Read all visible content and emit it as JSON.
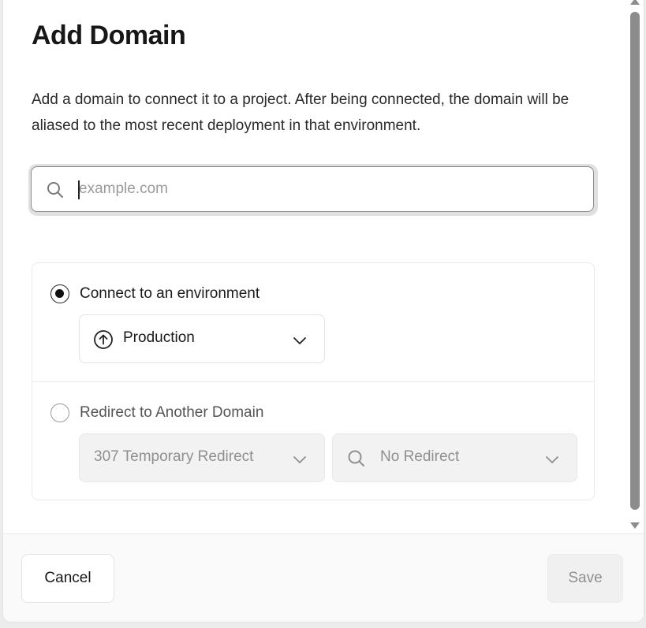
{
  "dialog": {
    "title": "Add Domain",
    "description": "Add a domain to connect it to a project. After being connected, the domain will be aliased to the most recent deployment in that environment."
  },
  "domain_input": {
    "value": "",
    "placeholder": "example.com",
    "icon": "search-icon"
  },
  "connect_option": {
    "label": "Connect to an environment",
    "selected": true,
    "environment_select": {
      "icon": "arrow-up-circle-icon",
      "value": "Production"
    }
  },
  "redirect_option": {
    "label": "Redirect to Another Domain",
    "selected": false,
    "redirect_type_select": {
      "value": "307 Temporary Redirect"
    },
    "redirect_target_select": {
      "icon": "search-icon",
      "value": "No Redirect"
    }
  },
  "footer": {
    "cancel_label": "Cancel",
    "save_label": "Save"
  }
}
